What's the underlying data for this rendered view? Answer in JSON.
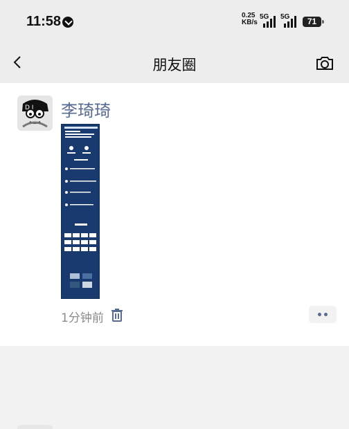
{
  "status_bar": {
    "time": "11:58",
    "network_speed_top": "0.25",
    "network_speed_bottom": "KB/s",
    "network_type_1": "5G",
    "network_type_2": "5G",
    "battery": "71"
  },
  "nav": {
    "title": "朋友圈",
    "back_icon": "chevron-left-icon",
    "camera_icon": "camera-icon"
  },
  "post": {
    "author": "李琦琦",
    "avatar_icon": "cartoon-avatar",
    "time_ago": "1分钟前",
    "delete_icon": "trash-icon",
    "more_icon": "more-dots-icon"
  },
  "colors": {
    "nav_background": "#ededed",
    "author_link": "#576b95",
    "poster_blue": "#193a6f"
  }
}
